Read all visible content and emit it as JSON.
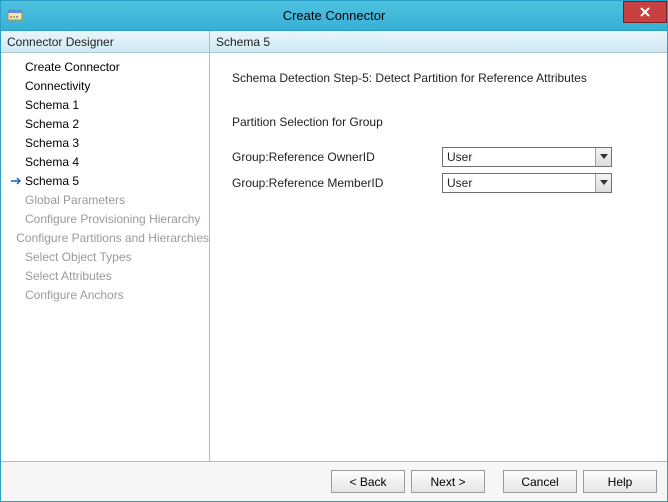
{
  "window": {
    "title": "Create Connector"
  },
  "sidebar": {
    "header": "Connector Designer",
    "items": [
      {
        "label": "Create Connector",
        "active": false,
        "disabled": false
      },
      {
        "label": "Connectivity",
        "active": false,
        "disabled": false
      },
      {
        "label": "Schema 1",
        "active": false,
        "disabled": false
      },
      {
        "label": "Schema 2",
        "active": false,
        "disabled": false
      },
      {
        "label": "Schema 3",
        "active": false,
        "disabled": false
      },
      {
        "label": "Schema 4",
        "active": false,
        "disabled": false
      },
      {
        "label": "Schema 5",
        "active": true,
        "disabled": false
      },
      {
        "label": "Global Parameters",
        "active": false,
        "disabled": true
      },
      {
        "label": "Configure Provisioning Hierarchy",
        "active": false,
        "disabled": true
      },
      {
        "label": "Configure Partitions and Hierarchies",
        "active": false,
        "disabled": true
      },
      {
        "label": "Select Object Types",
        "active": false,
        "disabled": true
      },
      {
        "label": "Select Attributes",
        "active": false,
        "disabled": true
      },
      {
        "label": "Configure Anchors",
        "active": false,
        "disabled": true
      }
    ]
  },
  "main": {
    "header": "Schema 5",
    "step_title": "Schema Detection Step-5: Detect Partition for Reference Attributes",
    "section_label": "Partition Selection for Group",
    "rows": [
      {
        "label": "Group:Reference OwnerID",
        "value": "User"
      },
      {
        "label": "Group:Reference MemberID",
        "value": "User"
      }
    ]
  },
  "footer": {
    "back": "< Back",
    "next": "Next >",
    "cancel": "Cancel",
    "help": "Help"
  }
}
